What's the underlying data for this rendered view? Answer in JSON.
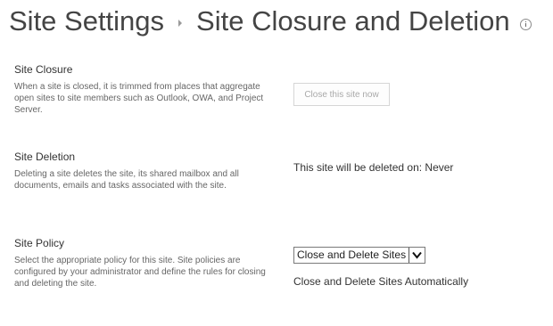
{
  "header": {
    "parent_title": "Site Settings",
    "current_title": "Site Closure and Deletion"
  },
  "sections": {
    "closure": {
      "heading": "Site Closure",
      "description": "When a site is closed, it is trimmed from places that aggregate open sites to site members such as Outlook, OWA, and Project Server.",
      "button_label": "Close this site now"
    },
    "deletion": {
      "heading": "Site Deletion",
      "description": "Deleting a site deletes the site, its shared mailbox and all documents, emails and tasks associated with the site.",
      "status_text": "This site will be deleted on: Never"
    },
    "policy": {
      "heading": "Site Policy",
      "description": "Select the appropriate policy for this site. Site policies are configured by your administrator and define the rules for closing and deleting the site.",
      "selected_policy": "Close and Delete Sites",
      "policy_description": "Close and Delete Sites Automatically"
    }
  },
  "icons": {
    "breadcrumb_separator": "chevron-right-icon",
    "info": "info-icon",
    "dropdown": "chevron-down-icon"
  }
}
